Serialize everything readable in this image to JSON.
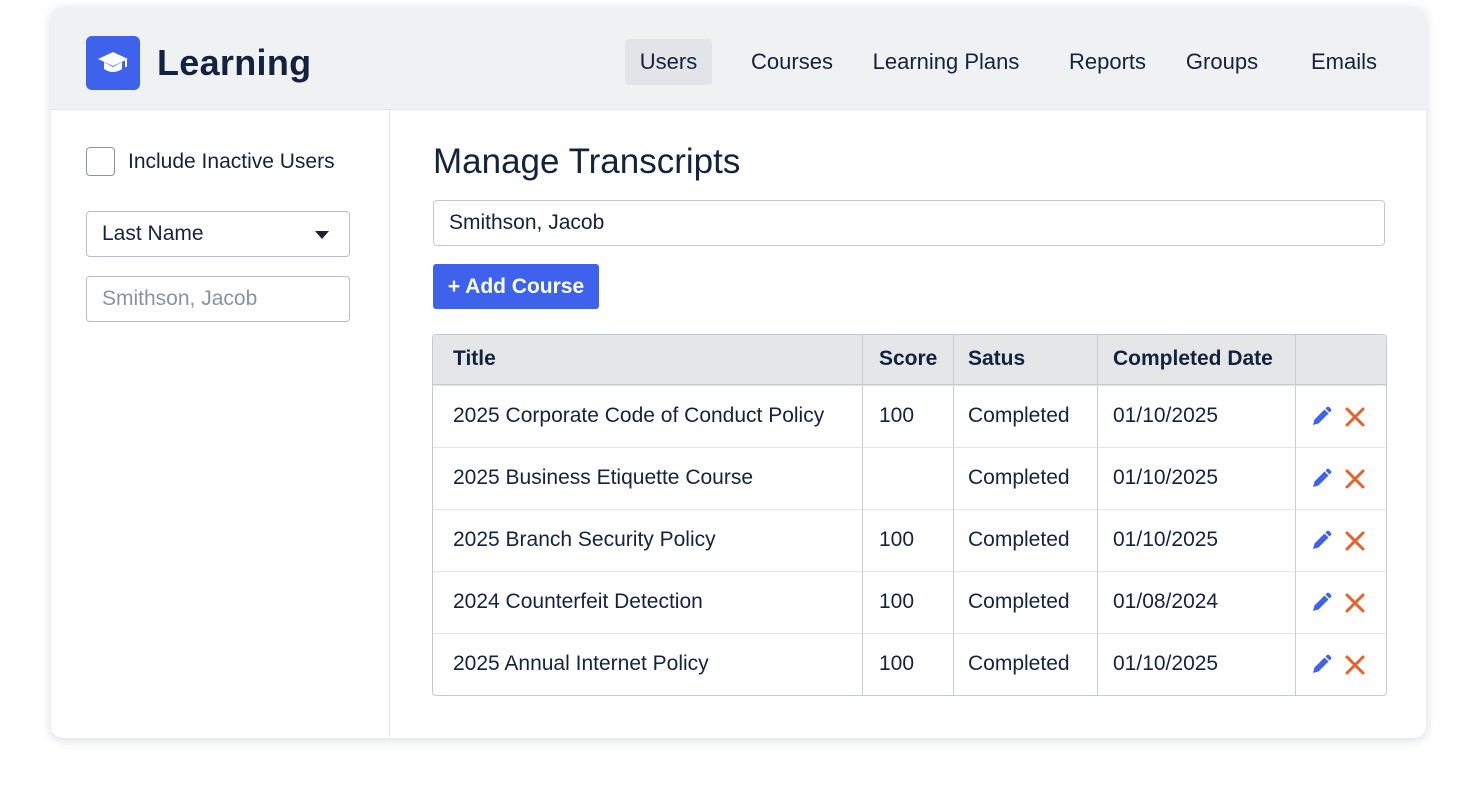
{
  "app": {
    "title": "Learning",
    "logo_icon": "graduation-cap-icon",
    "accent_color": "#3e62ec"
  },
  "nav": {
    "items": [
      {
        "label": "Users",
        "active": true
      },
      {
        "label": "Courses",
        "active": false
      },
      {
        "label": "Learning Plans",
        "active": false
      },
      {
        "label": "Reports",
        "active": false
      },
      {
        "label": "Groups",
        "active": false
      },
      {
        "label": "Emails",
        "active": false
      }
    ]
  },
  "sidebar": {
    "include_inactive_label": "Include Inactive Users",
    "include_inactive_checked": false,
    "sort_select_value": "Last Name",
    "search_placeholder": "Smithson, Jacob"
  },
  "main": {
    "title": "Manage Transcripts",
    "user_field_value": "Smithson, Jacob",
    "add_button_label": "+ Add Course",
    "table": {
      "headers": [
        "Title",
        "Score",
        "Satus",
        "Completed Date",
        ""
      ],
      "rows": [
        {
          "title": "2025 Corporate Code of Conduct Policy",
          "score": "100",
          "status": "Completed",
          "date": "01/10/2025"
        },
        {
          "title": "2025 Business Etiquette Course",
          "score": "",
          "status": "Completed",
          "date": "01/10/2025"
        },
        {
          "title": "2025 Branch Security Policy",
          "score": "100",
          "status": "Completed",
          "date": "01/10/2025"
        },
        {
          "title": "2024 Counterfeit Detection",
          "score": "100",
          "status": "Completed",
          "date": "01/08/2024"
        },
        {
          "title": "2025 Annual Internet Policy",
          "score": "100",
          "status": "Completed",
          "date": "01/10/2025"
        }
      ],
      "row_actions": [
        "edit-pencil-icon",
        "delete-x-icon"
      ],
      "edit_color": "#3e62ec",
      "delete_color": "#e5622b"
    }
  }
}
